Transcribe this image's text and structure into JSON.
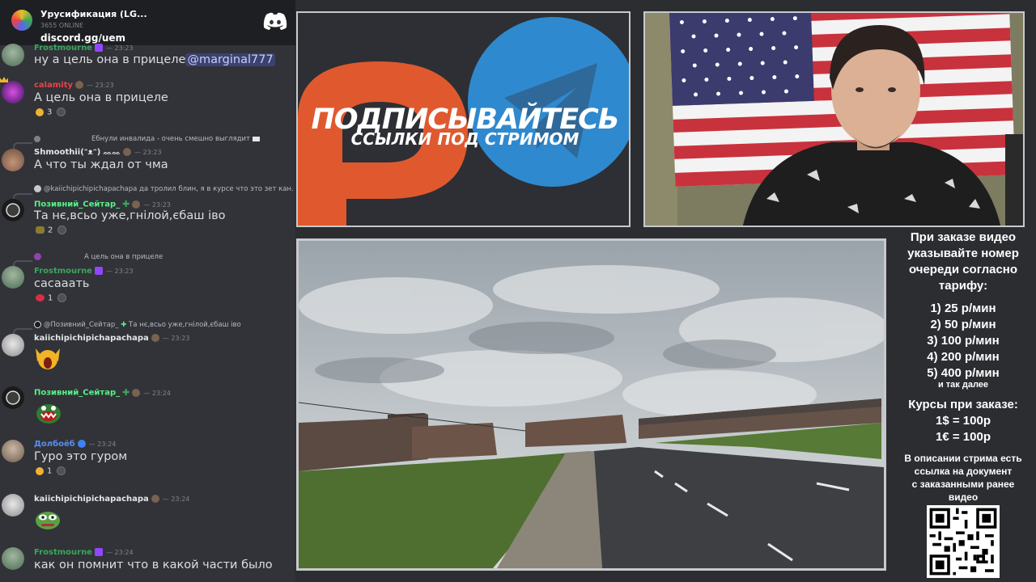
{
  "server": {
    "name": "Урусификация (LG...",
    "online": "3655 ONLINE",
    "invite": "discord.gg/uem"
  },
  "chat": {
    "m1": {
      "user": "Frostmourne",
      "time": "— 23:23",
      "text": "ну а цель она в прицеле",
      "mention": "@marginal777"
    },
    "m2": {
      "user": "calamity",
      "time": "— 23:23",
      "text": "А цель она в прицеле",
      "reaction": "3"
    },
    "m3": {
      "reply_user": "",
      "reply_text": "Ебнули инвалида - очень смешно выглядит",
      "user": "Shmoothii(ᵔᴥᵔ)",
      "user_extra": "ᨐᨐ",
      "time": "— 23:23",
      "text": "А что ты ждал от чма"
    },
    "m4": {
      "reply_user": "@kaiichipichipichapachapa",
      "reply_text": "да тролил блин, я в курсе что это зет кан.",
      "user": "Позивний_Сейтар_",
      "time": "— 23:23",
      "text": "Та нє,всьо уже,гнілой,єбаш іво",
      "reaction": "2"
    },
    "m5": {
      "reply_user": "",
      "reply_text": "А цель она в прицеле",
      "user": "Frostmourne",
      "time": "— 23:23",
      "text": "сасааать",
      "reaction": "1"
    },
    "m6": {
      "reply_user": "@Позивний_Сейтар_",
      "reply_text": "Та нє,всьо уже,гнілой,єбаш іво",
      "user": "kaiichipichipichapachapa",
      "time": "— 23:23"
    },
    "m7": {
      "user": "Позивний_Сейтар_",
      "time": "— 23:24"
    },
    "m8": {
      "user": "Долбоёб",
      "time": "— 23:24",
      "text": "Гуро это гуром",
      "reaction": "1"
    },
    "m9": {
      "user": "kaiichipichipichapachapa",
      "time": "— 23:24"
    },
    "m10": {
      "user": "Frostmourne",
      "time": "— 23:24",
      "text": "как он помнит что в какой части было"
    }
  },
  "promo": {
    "headline": "ПОДПИСЫВАЙТЕСЬ",
    "sub": "ССЫЛКИ ПОД СТРИМОМ"
  },
  "info": {
    "l1": "При заказе видео",
    "l2": "указывайте номер",
    "l3": "очереди согласно",
    "l4": "тарифу:",
    "p1": "1) 25 р/мин",
    "p2": "2) 50 р/мин",
    "p3": "3) 100 р/мин",
    "p4": "4) 200 р/мин",
    "p5": "5) 400 р/мин",
    "etc": "и так далее",
    "c1": "Курсы при заказе:",
    "c2": "1$ = 100р",
    "c3": "1€ = 100р",
    "d1": "В описании стрима есть",
    "d2": "ссылка на документ",
    "d3": "с заказанными ранее",
    "d4": "видео"
  },
  "colors": {
    "frostmourne": "#3ba55c",
    "calamity": "#ed4245",
    "seitar": "#57f287",
    "dolboeb": "#5b8def",
    "white": "#ffffff",
    "mention_bg": "#3c4270"
  }
}
